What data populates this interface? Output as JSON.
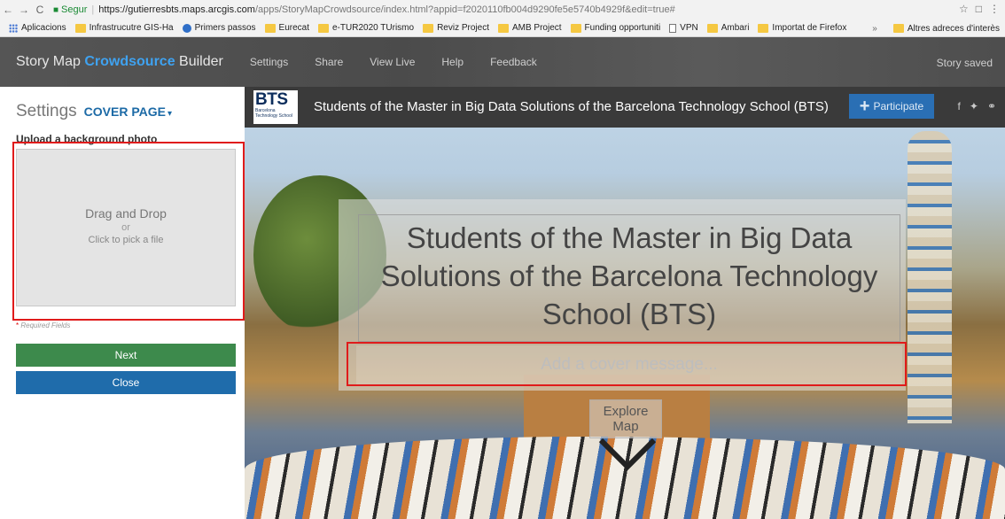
{
  "browser": {
    "secure_label": "Segur",
    "url_host": "https://gutierresbts.maps.arcgis.com",
    "url_path": "/apps/StoryMapCrowdsource/index.html?appid=f2020110fb004d9290fe5e5740b4929f&edit=true#",
    "bookmarks": [
      "Aplicacions",
      "Infrastrucutre GIS-Ha",
      "Primers passos",
      "Eurecat",
      "e-TUR2020 TUrismo",
      "Reviz Project",
      "AMB Project",
      "Funding opportuniti",
      "VPN",
      "Ambari",
      "Importat de Firefox"
    ],
    "bookmarks_more": "»",
    "other_bookmarks": "Altres adreces d'interès"
  },
  "app": {
    "title_prefix": "Story Map ",
    "title_accent": "Crowdsource",
    "title_suffix": " Builder",
    "nav": [
      "Settings",
      "Share",
      "View Live",
      "Help",
      "Feedback"
    ],
    "status": "Story saved"
  },
  "panel": {
    "title": "Settings",
    "section": "COVER PAGE",
    "upload_label": "Upload a background photo",
    "dropzone_main": "Drag and Drop",
    "dropzone_or": "or",
    "dropzone_pick": "Click to pick a file",
    "required_star": "*",
    "required_text": " Required Fields",
    "next_label": "Next",
    "close_label": "Close"
  },
  "preview": {
    "logo_text": "BTS",
    "logo_sub": "Barcelona Technology School",
    "header_title": "Students of the Master in Big Data Solutions of the Barcelona Technology School (BTS)",
    "participate_label": "Participate",
    "cover_title": "Students of the Master in Big Data Solutions of the Barcelona Technology School (BTS)",
    "message_placeholder": "Add a cover message...",
    "explore_label": "Explore Map"
  }
}
